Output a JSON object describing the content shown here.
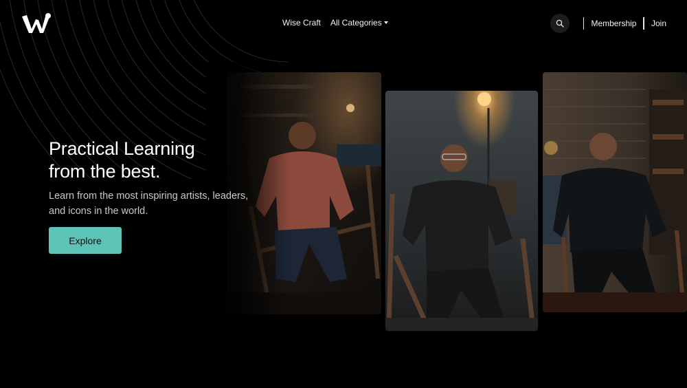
{
  "brand": {
    "logo_icon": "w-logo-icon"
  },
  "nav": {
    "wise_craft": "Wise Craft",
    "all_categories": "All Categories"
  },
  "header_right": {
    "search_icon": "search-icon",
    "membership": "Membership",
    "join": "Join"
  },
  "hero": {
    "title_line1": "Practical Learning",
    "title_line2": "from the best.",
    "subtitle_line1": "Learn from the most inspiring artists, leaders,",
    "subtitle_line2": "and icons in the world.",
    "cta_label": "Explore"
  },
  "colors": {
    "background": "#000000",
    "accent": "#5ec4b6",
    "text": "#ffffff",
    "muted_text": "#c9c9c9"
  }
}
